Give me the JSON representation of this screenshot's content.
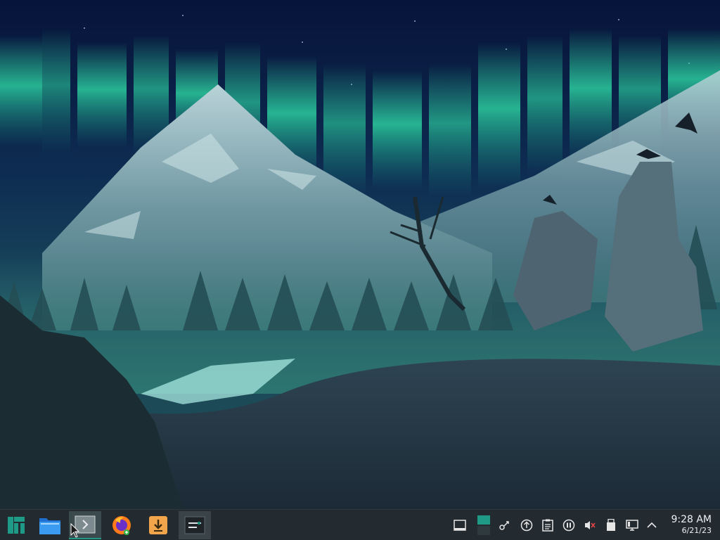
{
  "desktop": {
    "wallpaper": "aurora-mountains-ravens",
    "colors": {
      "sky_top": "#0a1a3a",
      "aurora": "#2fe0a8",
      "mountain": "#5f8a96",
      "snow": "#b8d6d8",
      "forest": "#2a5a5c",
      "foreground": "#243440"
    }
  },
  "taskbar": {
    "launchers": [
      {
        "name": "application-menu",
        "icon": "manjaro-logo-icon"
      },
      {
        "name": "file-manager",
        "icon": "folder-icon"
      },
      {
        "name": "terminal",
        "icon": "terminal-icon"
      },
      {
        "name": "firefox",
        "icon": "firefox-icon"
      },
      {
        "name": "software-updates",
        "icon": "download-arrow-icon"
      },
      {
        "name": "system-monitor",
        "icon": "system-monitor-icon"
      }
    ],
    "tray": [
      "show-desktop-icon",
      "virtual-desktop-icon",
      "network-share-icon",
      "updates-icon",
      "clipboard-icon",
      "media-pause-icon",
      "volume-muted-icon",
      "usb-icon",
      "display-icon",
      "expand-tray-icon"
    ],
    "clock": {
      "time": "9:28 AM",
      "date": "6/21/23"
    },
    "accent": "#1f9a86"
  }
}
